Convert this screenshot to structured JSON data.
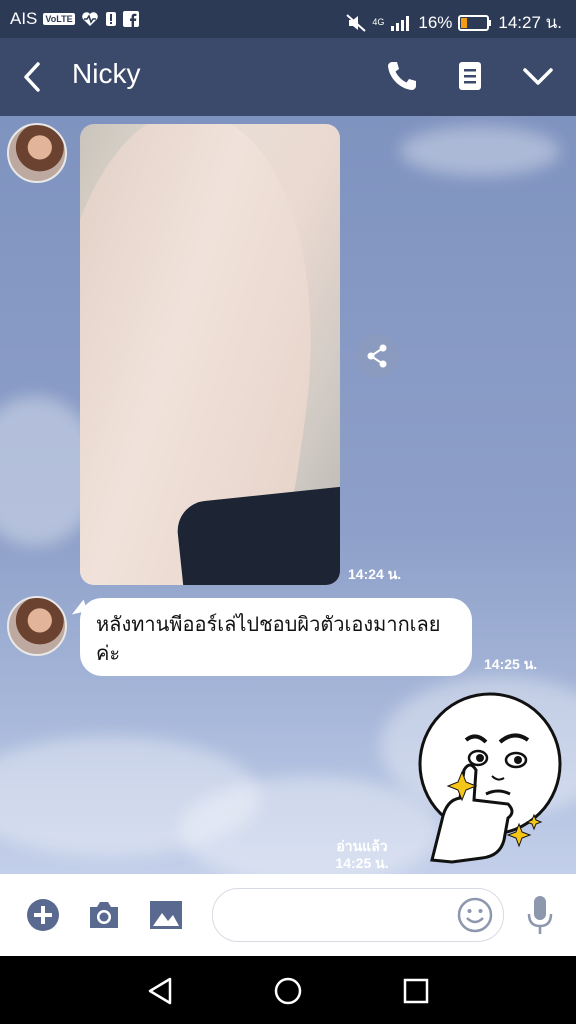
{
  "status_bar": {
    "carrier": "AIS",
    "volte": "VoLTE",
    "network_type": "4G",
    "battery_percent": "16%",
    "time": "14:27 น."
  },
  "header": {
    "contact_name": "Nicky",
    "icons": [
      "back-arrow-icon",
      "phone-icon",
      "notes-icon",
      "chevron-down-icon"
    ]
  },
  "messages": [
    {
      "type": "image",
      "sender": "Nicky",
      "time": "14:24 น."
    },
    {
      "type": "text",
      "sender": "Nicky",
      "text": "หลังทานพีออร์เล่ไปชอบผิวตัวเองมากเลยค่ะ",
      "time": "14:25 น."
    },
    {
      "type": "sticker",
      "sender": "me",
      "read_status": "อ่านแล้ว",
      "time": "14:25 น."
    }
  ],
  "input_bar": {
    "icons": [
      "plus-icon",
      "camera-icon",
      "gallery-icon",
      "emoji-icon",
      "microphone-icon"
    ],
    "placeholder": ""
  },
  "colors": {
    "header_bg": "#3b4a6b",
    "status_bg": "#2c3a55",
    "chat_bg": "#8597c2",
    "bubble_bg": "#ffffff"
  }
}
